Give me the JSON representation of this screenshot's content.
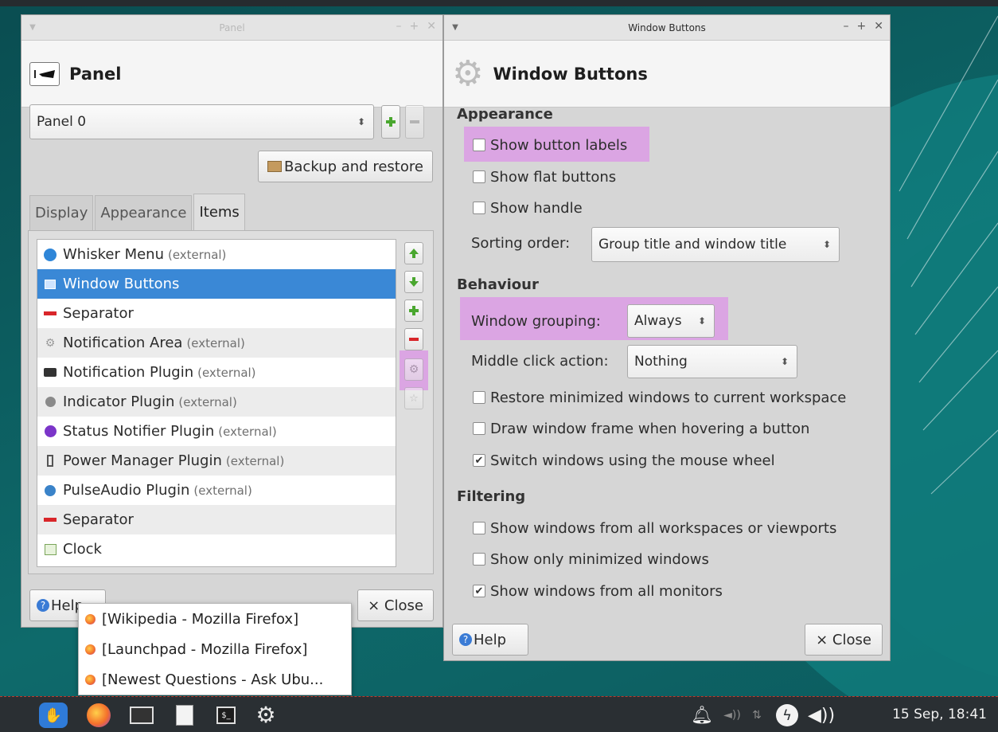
{
  "colors": {
    "accent_selection": "#3a88d6",
    "highlight": "#dba5e3",
    "desktop": "#0e5f62",
    "taskbar": "#2a2f33"
  },
  "panel_window": {
    "titlebar_title": "Panel",
    "titlebar_controls": [
      "–",
      "+",
      "✕"
    ],
    "header_title": "Panel",
    "panel_select": "Panel 0",
    "backup_label": "Backup and restore",
    "tabs": [
      "Display",
      "Appearance",
      "Items"
    ],
    "active_tab": "Items",
    "items": [
      {
        "label": "Whisker Menu",
        "ext": "(external)",
        "icon": "whisker-menu-icon",
        "selected": false
      },
      {
        "label": "Window Buttons",
        "ext": "",
        "icon": "window-buttons-icon",
        "selected": true
      },
      {
        "label": "Separator",
        "ext": "",
        "icon": "separator-icon",
        "selected": false
      },
      {
        "label": "Notification Area",
        "ext": "(external)",
        "icon": "gear-icon",
        "selected": false
      },
      {
        "label": "Notification Plugin",
        "ext": "(external)",
        "icon": "notification-plugin-icon",
        "selected": false
      },
      {
        "label": "Indicator Plugin",
        "ext": "(external)",
        "icon": "indicator-plugin-icon",
        "selected": false
      },
      {
        "label": "Status Notifier Plugin",
        "ext": "(external)",
        "icon": "status-notifier-icon",
        "selected": false
      },
      {
        "label": "Power Manager Plugin",
        "ext": "(external)",
        "icon": "battery-icon",
        "selected": false
      },
      {
        "label": "PulseAudio Plugin",
        "ext": "(external)",
        "icon": "pulseaudio-icon",
        "selected": false
      },
      {
        "label": "Separator",
        "ext": "",
        "icon": "separator-icon",
        "selected": false
      },
      {
        "label": "Clock",
        "ext": "",
        "icon": "clock-icon",
        "selected": false
      }
    ],
    "help_label": "Help",
    "close_label": "× Close"
  },
  "window_buttons_window": {
    "titlebar_title": "Window Buttons",
    "titlebar_controls": [
      "–",
      "+",
      "✕"
    ],
    "header_title": "Window Buttons",
    "sections": {
      "appearance": "Appearance",
      "behaviour": "Behaviour",
      "filtering": "Filtering"
    },
    "appearance_options": [
      {
        "label": "Show button labels",
        "checked": false
      },
      {
        "label": "Show flat buttons",
        "checked": false
      },
      {
        "label": "Show handle",
        "checked": false
      }
    ],
    "sorting_order_label": "Sorting order:",
    "sorting_order_value": "Group title and window title",
    "window_grouping_label": "Window grouping:",
    "window_grouping_value": "Always",
    "middle_click_label": "Middle click action:",
    "middle_click_value": "Nothing",
    "behaviour_options": [
      {
        "label": "Restore minimized windows to current workspace",
        "checked": false
      },
      {
        "label": "Draw window frame when hovering a button",
        "checked": false
      },
      {
        "label": "Switch windows using the mouse wheel",
        "checked": true
      }
    ],
    "filtering_options": [
      {
        "label": "Show windows from all workspaces or viewports",
        "checked": false
      },
      {
        "label": "Show only minimized windows",
        "checked": false
      },
      {
        "label": "Show windows from all monitors",
        "checked": true
      }
    ],
    "help_label": "Help",
    "close_label": "× Close"
  },
  "popup_menu": {
    "items": [
      "[Wikipedia - Mozilla Firefox]",
      "[Launchpad - Mozilla Firefox]",
      "[Newest Questions - Ask Ubu..."
    ]
  },
  "taskbar": {
    "clock": "15 Sep, 18:41",
    "launchers": [
      "whisker-menu-icon",
      "firefox-icon",
      "monitor-icon",
      "text-editor-icon",
      "terminal-icon",
      "settings-gear-icon"
    ],
    "tray": [
      "bell-icon",
      "volume-muted-icon",
      "network-icon",
      "power-icon",
      "volume-icon"
    ]
  }
}
